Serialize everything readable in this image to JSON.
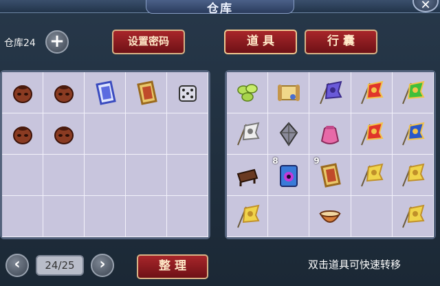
{
  "window": {
    "title": "仓库",
    "close_glyph": "✕"
  },
  "storage": {
    "label": "仓库24",
    "add_glyph": "+"
  },
  "buttons": {
    "set_password": "设置密码",
    "items_tab": "道 具",
    "bag_tab": "行 囊",
    "sort": "整 理"
  },
  "pagination": {
    "current": "24/25",
    "prev_glyph": "‹",
    "next_glyph": "›"
  },
  "hint": "双击道具可快速转移",
  "storage_grid": [
    {
      "icon": "clay-pot-icon"
    },
    {
      "icon": "clay-pot-icon"
    },
    {
      "icon": "blue-carpet-icon"
    },
    {
      "icon": "gold-carpet-icon"
    },
    {
      "icon": "dice-icon"
    },
    {
      "icon": "clay-pot-icon"
    },
    {
      "icon": "clay-pot-icon"
    },
    {
      "icon": ""
    },
    {
      "icon": ""
    },
    {
      "icon": ""
    },
    {
      "icon": ""
    },
    {
      "icon": ""
    },
    {
      "icon": ""
    },
    {
      "icon": ""
    },
    {
      "icon": ""
    },
    {
      "icon": ""
    },
    {
      "icon": ""
    },
    {
      "icon": ""
    },
    {
      "icon": ""
    },
    {
      "icon": ""
    }
  ],
  "bag_grid": [
    {
      "icon": "green-pills-icon",
      "count": ""
    },
    {
      "icon": "scroll-icon",
      "count": ""
    },
    {
      "icon": "purple-flag-icon",
      "count": ""
    },
    {
      "icon": "red-flag-icon",
      "count": ""
    },
    {
      "icon": "green-flag-icon",
      "count": ""
    },
    {
      "icon": "white-flag-icon",
      "count": ""
    },
    {
      "icon": "kite-icon",
      "count": ""
    },
    {
      "icon": "pink-pouch-icon",
      "count": ""
    },
    {
      "icon": "red-flag-icon",
      "count": ""
    },
    {
      "icon": "blue-flag-icon",
      "count": ""
    },
    {
      "icon": "bench-icon",
      "count": ""
    },
    {
      "icon": "eye-book-icon",
      "count": "8"
    },
    {
      "icon": "gold-carpet-icon",
      "count": "9"
    },
    {
      "icon": "yellow-flag-icon",
      "count": ""
    },
    {
      "icon": "yellow-flag-icon",
      "count": ""
    },
    {
      "icon": "yellow-flag-icon",
      "count": ""
    },
    {
      "icon": "",
      "count": ""
    },
    {
      "icon": "bowl-icon",
      "count": ""
    },
    {
      "icon": "",
      "count": ""
    },
    {
      "icon": "yellow-flag-icon",
      "count": ""
    }
  ],
  "colors": {
    "panel": "#c9c6de",
    "button_red": "#8f1c20",
    "frame": "#1f2e3c"
  }
}
